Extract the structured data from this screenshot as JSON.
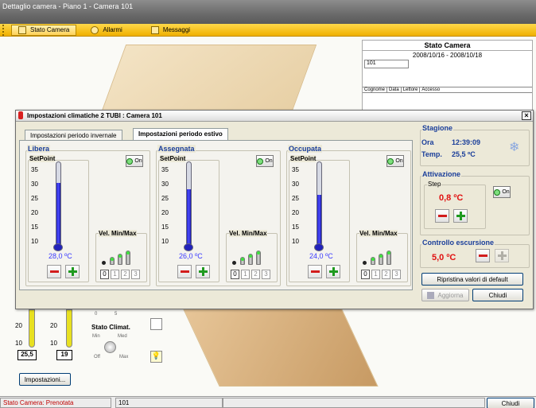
{
  "window": {
    "title": "Dettaglio camera - Piano 1 - Camera 101"
  },
  "menu": [
    {
      "label": "Stato Camera",
      "icon": "room-icon"
    },
    {
      "label": "Allarmi",
      "icon": "alarm-icon"
    },
    {
      "label": "Messaggi",
      "icon": "envelope-icon"
    }
  ],
  "right_panel": {
    "title": "Stato Camera",
    "dates": "2008/10/16 - 2008/10/18",
    "room": "101",
    "columns": [
      "Cognome",
      "Data",
      "Lettore",
      "Accesso"
    ]
  },
  "dialog": {
    "title": "Impostazioni climatiche 2 TUBI : Camera 101",
    "tabs": [
      "Impostazioni periodo invernale",
      "Impostazioni periodo estivo"
    ],
    "setpoint_label": "SetPoint",
    "on_label": "On",
    "vel_label": "Vel. Min/Max",
    "ticks": [
      "35",
      "30",
      "25",
      "20",
      "15",
      "10"
    ],
    "vel_steps": [
      "0",
      "1",
      "2",
      "3"
    ],
    "zones": [
      {
        "name": "Libera",
        "value": "28,0 ºC",
        "setpoint": 28.0
      },
      {
        "name": "Assegnata",
        "value": "26,0 ºC",
        "setpoint": 26.0
      },
      {
        "name": "Occupata",
        "value": "24,0 ºC",
        "setpoint": 24.0
      }
    ],
    "stagione": {
      "title": "Stagione",
      "ora_label": "Ora",
      "ora": "12:39:09",
      "temp_label": "Temp.",
      "temp": "25,5 ºC"
    },
    "attivazione": {
      "title": "Attivazione",
      "step_label": "Step",
      "step_value": "0,8 ºC"
    },
    "escursione": {
      "title": "Controllo escursione",
      "value": "5,0 ºC"
    },
    "buttons": {
      "reset": "Ripristina valori di default",
      "update": "Aggiorna",
      "close": "Chiudi"
    }
  },
  "lower": {
    "left_temp": "25,5",
    "right_temp": "19",
    "ticks_a": [
      "20",
      "10"
    ],
    "ticks_b": [
      "20",
      "10"
    ],
    "stato": "Stato Climat.",
    "dial": {
      "min": "Min",
      "med": "Med",
      "off": "Off",
      "max": "Max",
      "zero": "0",
      "five": "5"
    },
    "settings_button": "Impostazioni..."
  },
  "statusbar": {
    "status": "Stato Camera: Prenotata",
    "room": "101",
    "close": "Chiudi"
  },
  "colors": {
    "accent": "#f0b000",
    "status_red": "#c00000",
    "blue": "#3a3aff"
  }
}
